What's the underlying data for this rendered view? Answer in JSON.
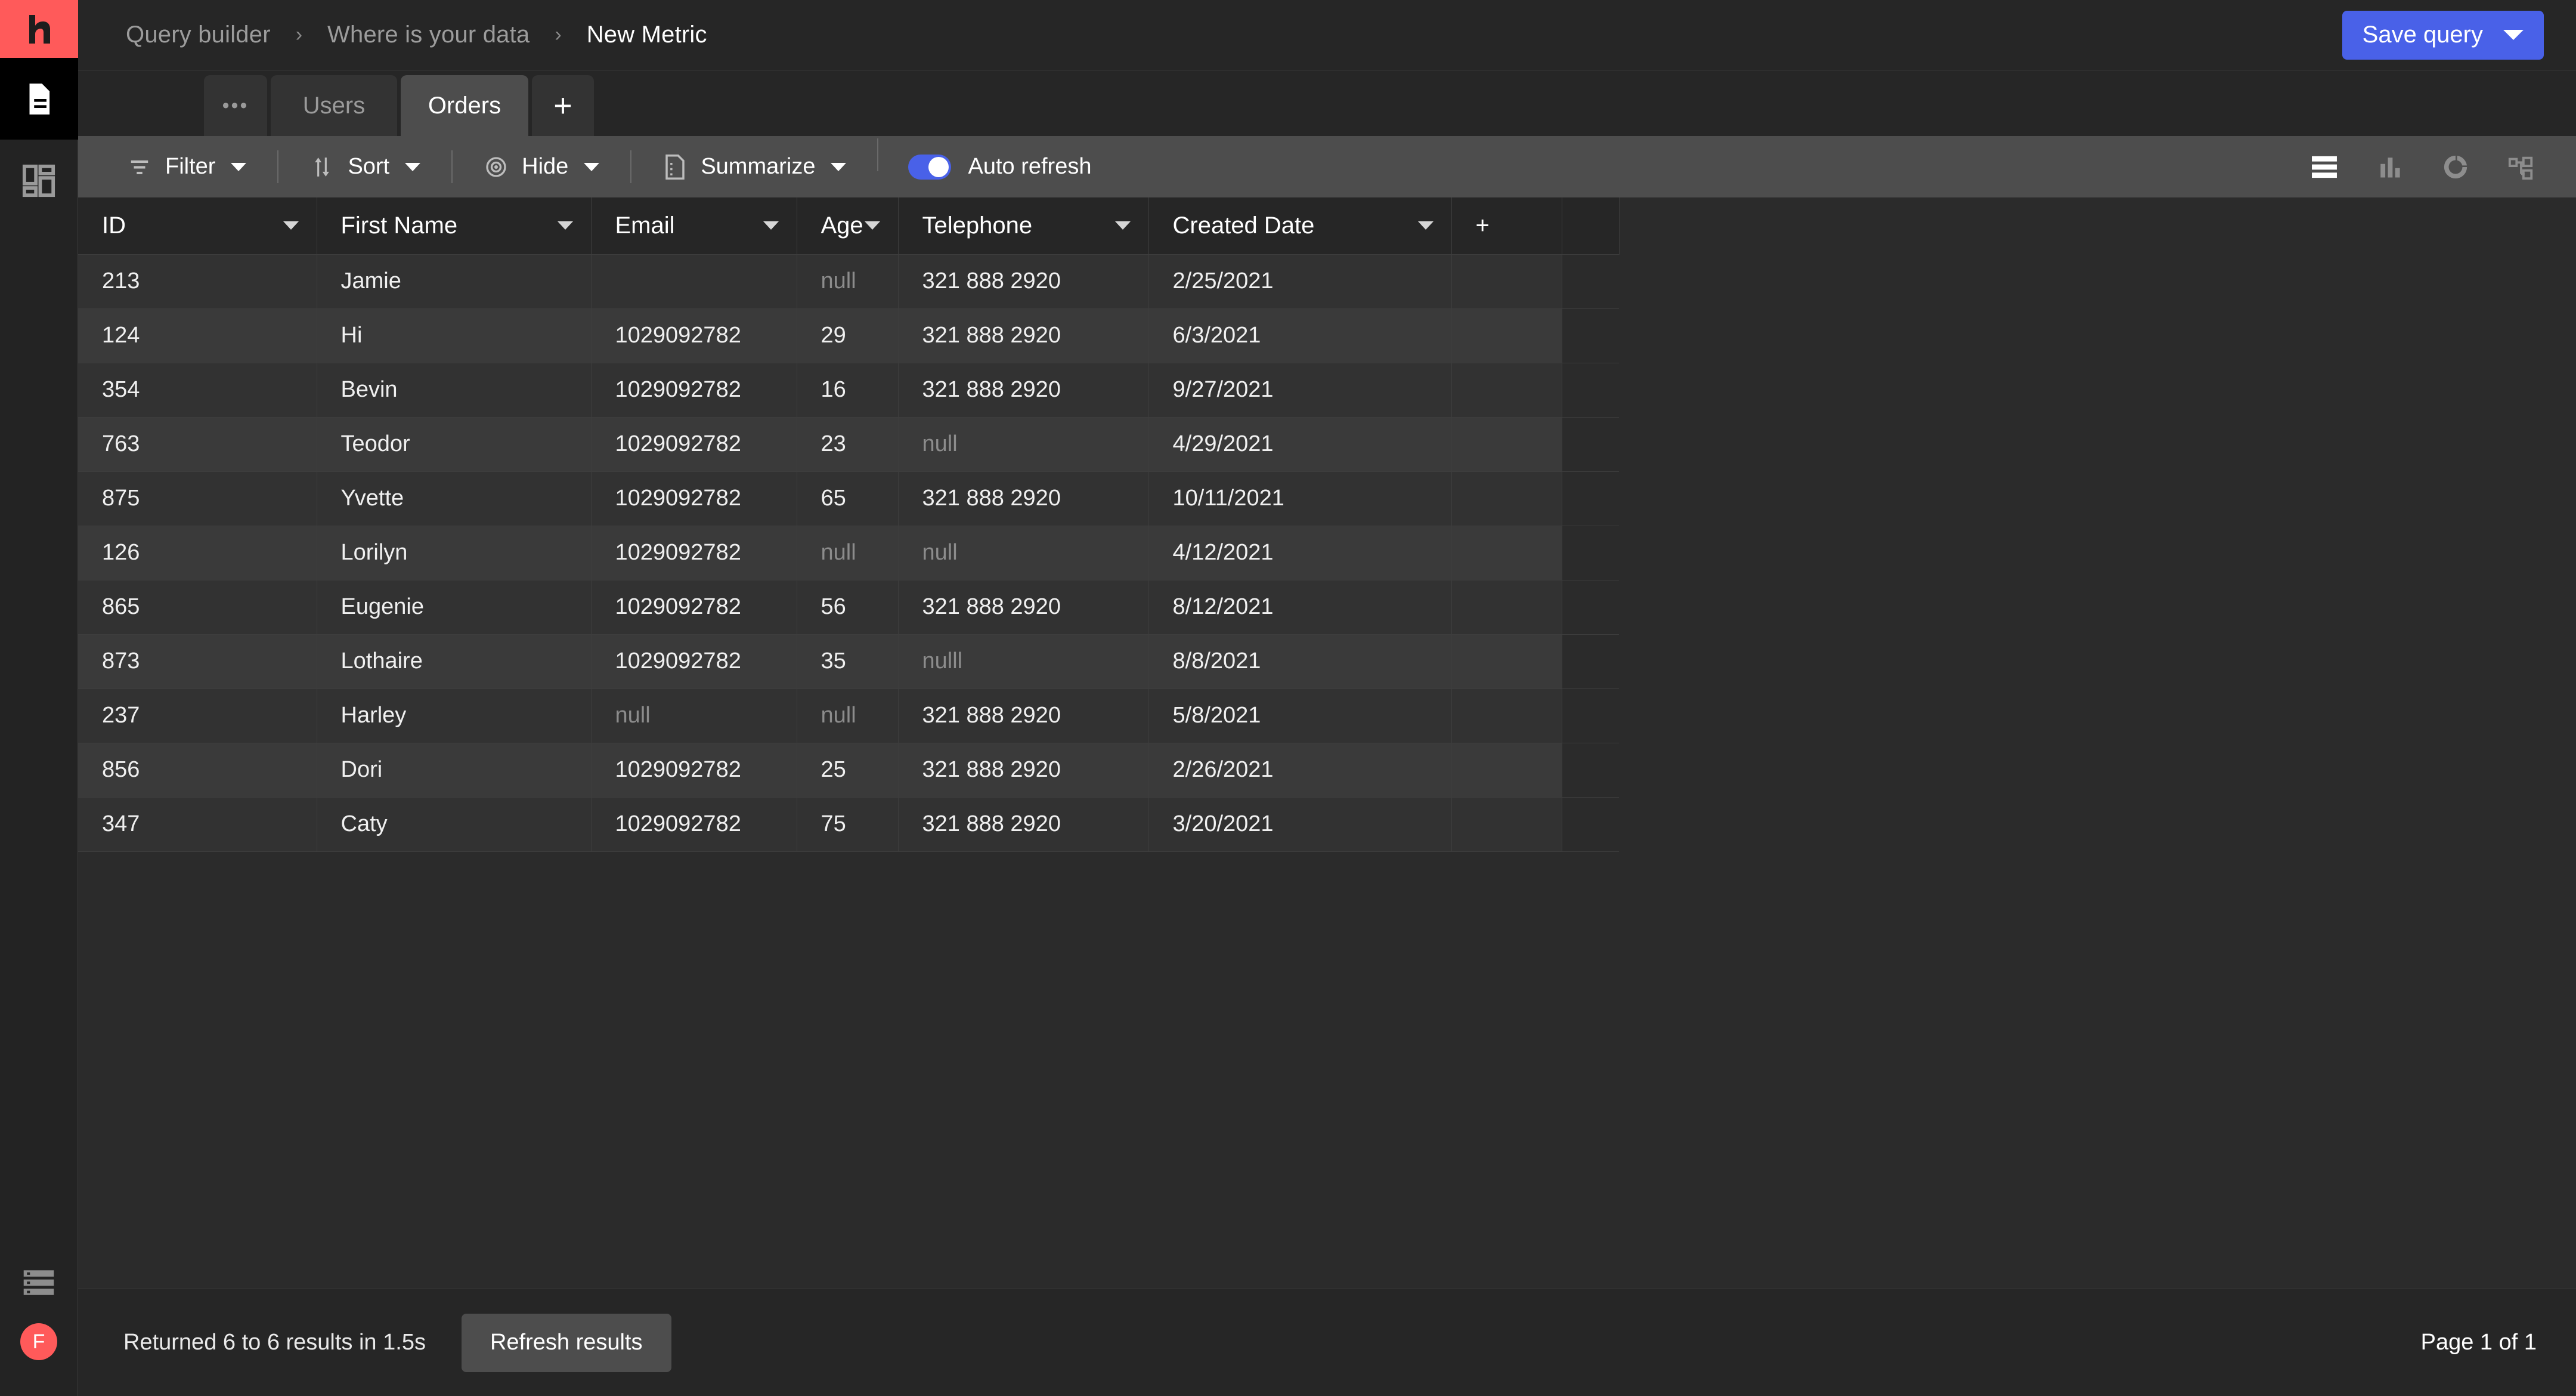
{
  "brand": {
    "logo_letter": "h",
    "logo_color": "#ff5a5a",
    "accent_color": "#4961e8"
  },
  "rail": {
    "items": [
      {
        "icon": "document-icon",
        "active": true
      },
      {
        "icon": "dashboard-grid-icon",
        "active": false
      },
      {
        "icon": "database-stack-icon",
        "active": false
      }
    ],
    "avatar_initial": "F"
  },
  "topbar": {
    "breadcrumbs": [
      {
        "label": "Query builder",
        "current": false
      },
      {
        "label": "Where is your data",
        "current": false
      },
      {
        "label": "New Metric",
        "current": true
      }
    ],
    "separator": "›",
    "save_label": "Save query"
  },
  "tabs": {
    "more_label": "•••",
    "items": [
      {
        "label": "Users",
        "active": false
      },
      {
        "label": "Orders",
        "active": true
      }
    ],
    "add_label": "+"
  },
  "toolbar": {
    "filter_label": "Filter",
    "sort_label": "Sort",
    "hide_label": "Hide",
    "summarize_label": "Summarize",
    "auto_refresh_label": "Auto refresh",
    "auto_refresh_on": true,
    "views": [
      {
        "icon": "table-view-icon",
        "active": true
      },
      {
        "icon": "bar-chart-view-icon",
        "active": false
      },
      {
        "icon": "donut-chart-view-icon",
        "active": false
      },
      {
        "icon": "node-tree-view-icon",
        "active": false
      }
    ]
  },
  "table": {
    "columns": [
      "ID",
      "First Name",
      "Email",
      "Age",
      "Telephone",
      "Created Date"
    ],
    "add_column_label": "+",
    "rows": [
      {
        "id": "213",
        "first_name": "Jamie",
        "email": "",
        "age": "null",
        "telephone": "321 888 2920",
        "created": "2/25/2021"
      },
      {
        "id": "124",
        "first_name": "Hi",
        "email": "1029092782",
        "age": "29",
        "telephone": "321 888 2920",
        "created": "6/3/2021"
      },
      {
        "id": "354",
        "first_name": "Bevin",
        "email": "1029092782",
        "age": "16",
        "telephone": "321 888 2920",
        "created": "9/27/2021"
      },
      {
        "id": "763",
        "first_name": "Teodor",
        "email": "1029092782",
        "age": "23",
        "telephone": "null",
        "created": "4/29/2021"
      },
      {
        "id": "875",
        "first_name": "Yvette",
        "email": "1029092782",
        "age": "65",
        "telephone": "321 888 2920",
        "created": "10/11/2021"
      },
      {
        "id": "126",
        "first_name": "Lorilyn",
        "email": "1029092782",
        "age": "null",
        "telephone": "null",
        "created": "4/12/2021"
      },
      {
        "id": "865",
        "first_name": "Eugenie",
        "email": "1029092782",
        "age": "56",
        "telephone": "321 888 2920",
        "created": "8/12/2021"
      },
      {
        "id": "873",
        "first_name": "Lothaire",
        "email": "1029092782",
        "age": "35",
        "telephone": "nulll",
        "created": "8/8/2021"
      },
      {
        "id": "237",
        "first_name": "Harley",
        "email": "null",
        "age": "null",
        "telephone": "321 888 2920",
        "created": "5/8/2021"
      },
      {
        "id": "856",
        "first_name": "Dori",
        "email": "1029092782",
        "age": "25",
        "telephone": "321 888 2920",
        "created": "2/26/2021"
      },
      {
        "id": "347",
        "first_name": "Caty",
        "email": "1029092782",
        "age": "75",
        "telephone": "321 888 2920",
        "created": "3/20/2021"
      }
    ]
  },
  "footer": {
    "status": "Returned 6 to 6 results in 1.5s",
    "refresh_label": "Refresh results",
    "page_label": "Page 1 of 1"
  }
}
